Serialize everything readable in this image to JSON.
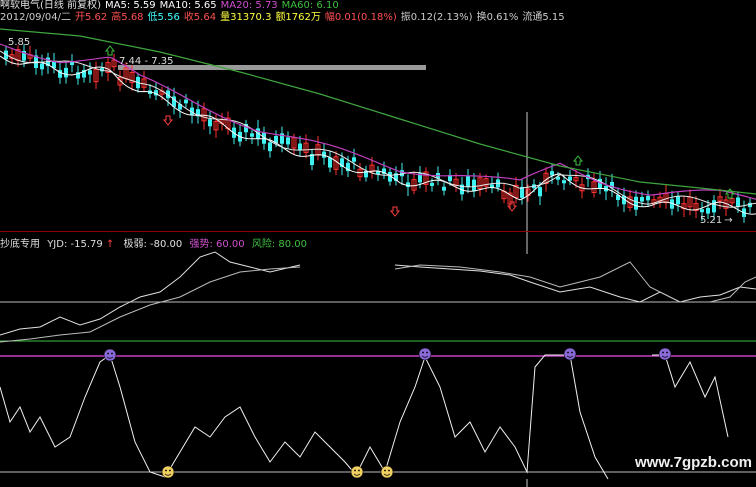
{
  "header": {
    "line1": [
      {
        "text": "啊软电气(日线 前复权)",
        "color": "#e0e0e0"
      },
      {
        "text": "MA5: 5.59",
        "color": "#ffffff"
      },
      {
        "text": "MA10: 5.65",
        "color": "#ffffff"
      },
      {
        "text": "MA20: 5.73",
        "color": "#d04fd0"
      },
      {
        "text": "MA60: 6.10",
        "color": "#3fbf3f"
      }
    ],
    "line2": [
      {
        "text": "2012/09/04/二",
        "color": "#cccccc"
      },
      {
        "text": "开5.62",
        "color": "#ff5050"
      },
      {
        "text": "高5.68",
        "color": "#ff5050"
      },
      {
        "text": "低5.56",
        "color": "#40ffff"
      },
      {
        "text": "收5.64",
        "color": "#ff5050"
      },
      {
        "text": "量31370.3",
        "color": "#ffff40"
      },
      {
        "text": "额1762万",
        "color": "#ffff40"
      },
      {
        "text": "幅0.01(0.18%)",
        "color": "#ff5050"
      },
      {
        "text": "振0.12(2.13%)",
        "color": "#cccccc"
      },
      {
        "text": "换0.61%",
        "color": "#cccccc"
      },
      {
        "text": "流通5.15",
        "color": "#cccccc"
      }
    ]
  },
  "price_labels": {
    "high_left": "5.85",
    "range_label": "7.44 - 7.35",
    "low_right": "5.21"
  },
  "indicator": {
    "name": "抄底专用",
    "yjd": "YJD: -15.79",
    "jiruo": "极弱: -80.00",
    "qiangshi": "强势: 60.00",
    "fengxian": "风险: 80.00"
  },
  "watermark": "www.7gpzb.com",
  "colors": {
    "up": "#ff3030",
    "down": "#3ff0f0",
    "ma5": "#ffffff",
    "ma10": "#e8e8e8",
    "ma20": "#c040c0",
    "ma60": "#3fa53f",
    "separator": "#8a0000"
  }
}
